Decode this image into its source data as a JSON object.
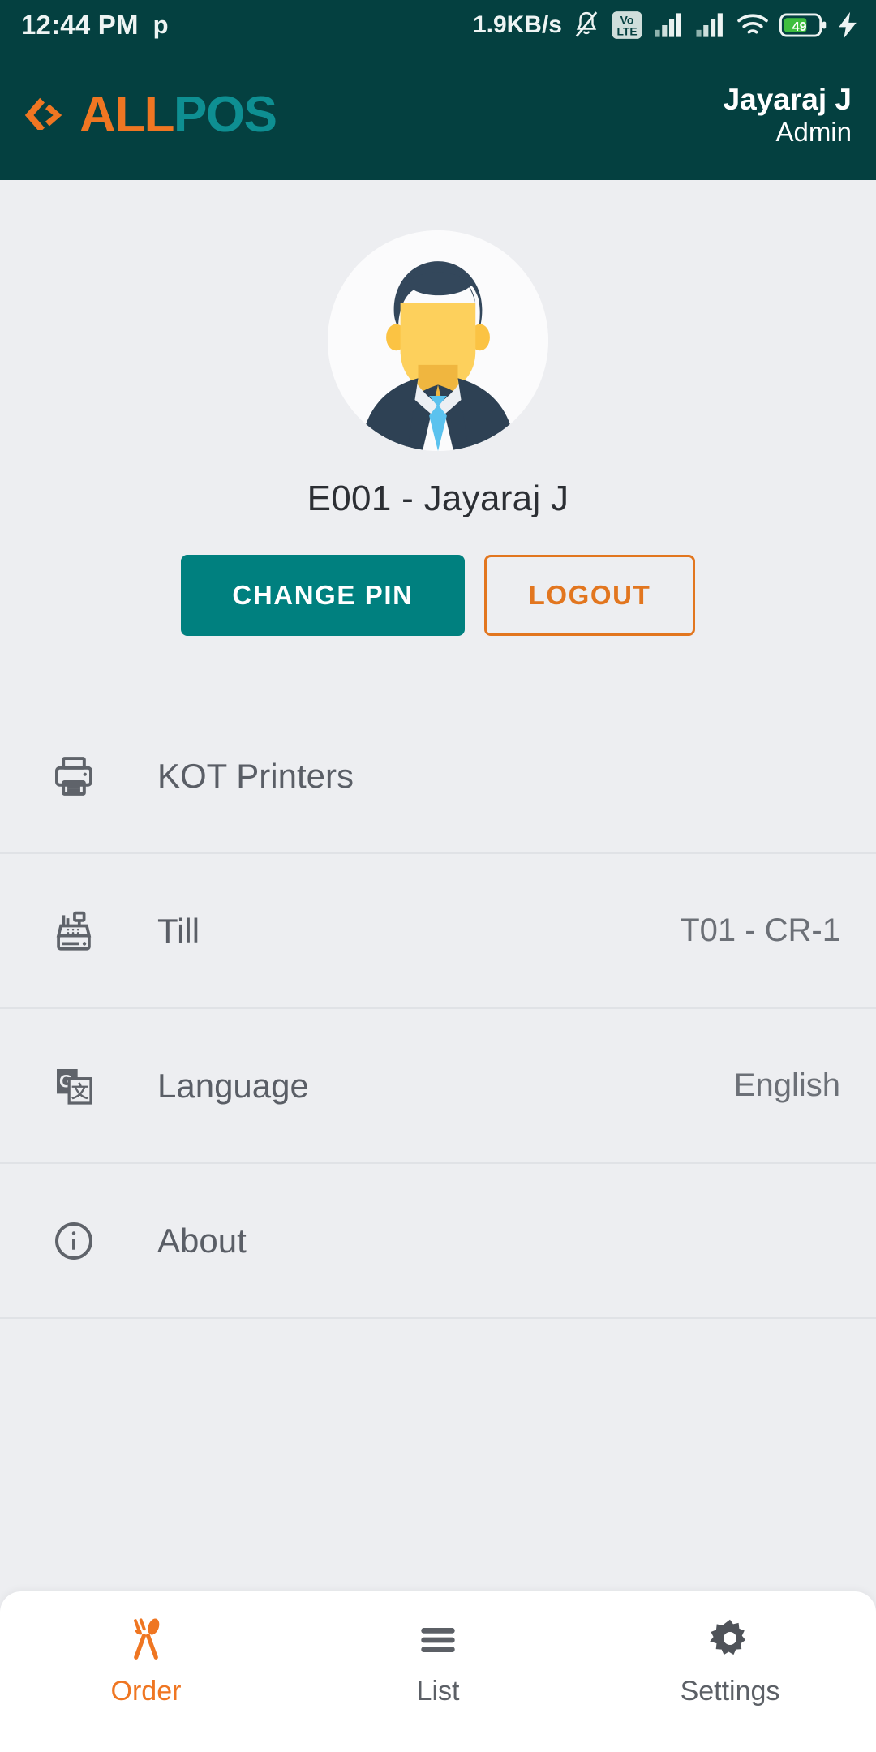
{
  "status_bar": {
    "time": "12:44 PM",
    "p_icon": "p-letter-icon",
    "network_speed": "1.9KB/s",
    "mute_icon": "bell-muted-icon",
    "volte_top": "Vo",
    "volte_bottom": "LTE",
    "signal1_icon": "signal-bars-icon",
    "signal2_icon": "signal-bars-icon",
    "wifi_icon": "wifi-icon",
    "battery_level": "49",
    "charging_icon": "lightning-bolt-icon",
    "bg_color": "#044040"
  },
  "header": {
    "logo_mark": "code-chevron-icon",
    "logo_part1": "ALL",
    "logo_part2": "POS",
    "logo_color1": "#ef7622",
    "logo_color2": "#0e8f92",
    "user_name": "Jayaraj J",
    "user_role": "Admin"
  },
  "profile": {
    "avatar_icon": "user-avatar-illustration",
    "display_name": "E001 - Jayaraj J",
    "change_pin_label": "CHANGE PIN",
    "logout_label": "LOGOUT",
    "primary_color": "#00807f",
    "accent_color": "#e2761f"
  },
  "settings_rows": [
    {
      "icon": "printer-icon",
      "label": "KOT Printers",
      "value": ""
    },
    {
      "icon": "cash-register-icon",
      "label": "Till",
      "value": "T01 - CR-1"
    },
    {
      "icon": "translate-icon",
      "label": "Language",
      "value": "English"
    },
    {
      "icon": "info-circle-icon",
      "label": "About",
      "value": ""
    }
  ],
  "bottom_nav": [
    {
      "icon": "fork-spoon-icon",
      "label": "Order",
      "active": true
    },
    {
      "icon": "hamburger-list-icon",
      "label": "List",
      "active": false
    },
    {
      "icon": "gear-icon",
      "label": "Settings",
      "active": false
    }
  ]
}
